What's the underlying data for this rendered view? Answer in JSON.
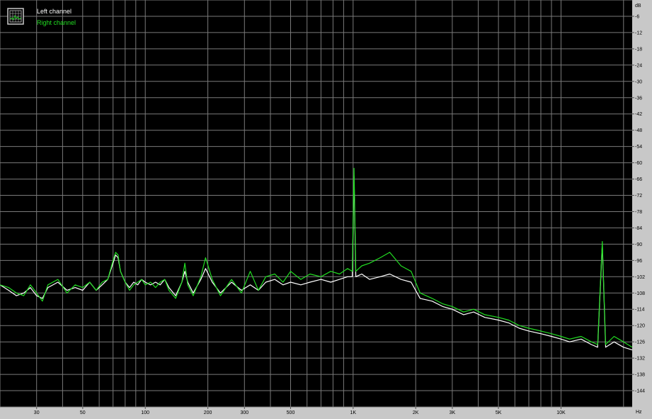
{
  "chart_data": {
    "type": "line",
    "title": "",
    "x_scale": "log",
    "xlim": [
      20,
      22000
    ],
    "ylim": [
      -150,
      0
    ],
    "x_unit": "Hz",
    "y_unit": "dB",
    "x_tick_labels": [
      {
        "f": 30,
        "label": "30"
      },
      {
        "f": 50,
        "label": "50"
      },
      {
        "f": 100,
        "label": "100"
      },
      {
        "f": 200,
        "label": "200"
      },
      {
        "f": 300,
        "label": "300"
      },
      {
        "f": 500,
        "label": "500"
      },
      {
        "f": 1000,
        "label": "1K"
      },
      {
        "f": 2000,
        "label": "2K"
      },
      {
        "f": 3000,
        "label": "3K"
      },
      {
        "f": 5000,
        "label": "5K"
      },
      {
        "f": 10000,
        "label": "10K"
      }
    ],
    "y_tick_labels": [
      "-6",
      "-12",
      "-18",
      "-24",
      "-30",
      "-36",
      "-42",
      "-48",
      "-54",
      "-60",
      "-66",
      "-72",
      "-78",
      "-84",
      "-90",
      "-96",
      "-102",
      "-108",
      "-114",
      "-120",
      "-126",
      "-132",
      "-138",
      "-144"
    ],
    "grid": true,
    "legend_position": "top-left",
    "colors": {
      "background": "#000000",
      "grid": "#7a7a7a",
      "frame": "#c8c8c8",
      "left": "#ffffff",
      "right": "#22dd22"
    },
    "legend": {
      "left_label": "Left channel",
      "right_label": "Right channel",
      "icon": "graph-icon"
    },
    "series": [
      {
        "name": "Left channel",
        "points": [
          [
            20,
            -105
          ],
          [
            22,
            -107
          ],
          [
            24,
            -109
          ],
          [
            26,
            -108
          ],
          [
            28,
            -106
          ],
          [
            30,
            -109
          ],
          [
            32,
            -110
          ],
          [
            34,
            -106
          ],
          [
            38,
            -104
          ],
          [
            42,
            -107
          ],
          [
            46,
            -106
          ],
          [
            50,
            -107
          ],
          [
            54,
            -104
          ],
          [
            58,
            -107
          ],
          [
            62,
            -105
          ],
          [
            66,
            -103
          ],
          [
            70,
            -97
          ],
          [
            72,
            -94
          ],
          [
            74,
            -95
          ],
          [
            76,
            -100
          ],
          [
            80,
            -104
          ],
          [
            84,
            -106
          ],
          [
            88,
            -104
          ],
          [
            92,
            -105
          ],
          [
            96,
            -103
          ],
          [
            100,
            -104
          ],
          [
            106,
            -105
          ],
          [
            112,
            -104
          ],
          [
            118,
            -105
          ],
          [
            124,
            -103
          ],
          [
            130,
            -106
          ],
          [
            140,
            -109
          ],
          [
            150,
            -104
          ],
          [
            155,
            -100
          ],
          [
            160,
            -104
          ],
          [
            170,
            -108
          ],
          [
            185,
            -103
          ],
          [
            195,
            -99
          ],
          [
            210,
            -104
          ],
          [
            230,
            -108
          ],
          [
            260,
            -104
          ],
          [
            290,
            -107
          ],
          [
            320,
            -105
          ],
          [
            350,
            -107
          ],
          [
            380,
            -104
          ],
          [
            420,
            -103
          ],
          [
            460,
            -105
          ],
          [
            500,
            -104
          ],
          [
            560,
            -105
          ],
          [
            620,
            -104
          ],
          [
            700,
            -103
          ],
          [
            780,
            -104
          ],
          [
            860,
            -103
          ],
          [
            940,
            -102
          ],
          [
            990,
            -102
          ],
          [
            1010,
            -65
          ],
          [
            1030,
            -102
          ],
          [
            1100,
            -101
          ],
          [
            1200,
            -103
          ],
          [
            1350,
            -102
          ],
          [
            1500,
            -101
          ],
          [
            1700,
            -103
          ],
          [
            1900,
            -104
          ],
          [
            2100,
            -110
          ],
          [
            2400,
            -111
          ],
          [
            2700,
            -113
          ],
          [
            3000,
            -114
          ],
          [
            3400,
            -116
          ],
          [
            3800,
            -115
          ],
          [
            4300,
            -117
          ],
          [
            5000,
            -118
          ],
          [
            5600,
            -119
          ],
          [
            6300,
            -121
          ],
          [
            7000,
            -122
          ],
          [
            8000,
            -123
          ],
          [
            9000,
            -124
          ],
          [
            10000,
            -125
          ],
          [
            11000,
            -126
          ],
          [
            12500,
            -125
          ],
          [
            14000,
            -127
          ],
          [
            15000,
            -128
          ],
          [
            15800,
            -90
          ],
          [
            16400,
            -128
          ],
          [
            18000,
            -126
          ],
          [
            20000,
            -128
          ],
          [
            22000,
            -129
          ]
        ]
      },
      {
        "name": "Right channel",
        "points": [
          [
            20,
            -105
          ],
          [
            22,
            -106
          ],
          [
            24,
            -108
          ],
          [
            26,
            -109
          ],
          [
            28,
            -105
          ],
          [
            30,
            -108
          ],
          [
            32,
            -111
          ],
          [
            34,
            -105
          ],
          [
            38,
            -103
          ],
          [
            42,
            -108
          ],
          [
            46,
            -105
          ],
          [
            50,
            -106
          ],
          [
            54,
            -104
          ],
          [
            58,
            -107
          ],
          [
            62,
            -104
          ],
          [
            66,
            -103
          ],
          [
            70,
            -96
          ],
          [
            72,
            -93
          ],
          [
            74,
            -94
          ],
          [
            76,
            -100
          ],
          [
            80,
            -104
          ],
          [
            84,
            -107
          ],
          [
            88,
            -105
          ],
          [
            92,
            -104
          ],
          [
            96,
            -103
          ],
          [
            100,
            -105
          ],
          [
            106,
            -104
          ],
          [
            112,
            -106
          ],
          [
            118,
            -104
          ],
          [
            124,
            -103
          ],
          [
            130,
            -107
          ],
          [
            140,
            -110
          ],
          [
            150,
            -104
          ],
          [
            155,
            -97
          ],
          [
            160,
            -105
          ],
          [
            170,
            -109
          ],
          [
            185,
            -102
          ],
          [
            195,
            -95
          ],
          [
            210,
            -103
          ],
          [
            230,
            -109
          ],
          [
            260,
            -103
          ],
          [
            290,
            -108
          ],
          [
            320,
            -100
          ],
          [
            350,
            -107
          ],
          [
            380,
            -102
          ],
          [
            420,
            -101
          ],
          [
            460,
            -104
          ],
          [
            500,
            -100
          ],
          [
            560,
            -103
          ],
          [
            620,
            -101
          ],
          [
            700,
            -102
          ],
          [
            780,
            -100
          ],
          [
            860,
            -101
          ],
          [
            940,
            -99
          ],
          [
            990,
            -100
          ],
          [
            1010,
            -62
          ],
          [
            1030,
            -100
          ],
          [
            1100,
            -98
          ],
          [
            1200,
            -97
          ],
          [
            1350,
            -95
          ],
          [
            1500,
            -93
          ],
          [
            1700,
            -98
          ],
          [
            1900,
            -100
          ],
          [
            2100,
            -108
          ],
          [
            2400,
            -110
          ],
          [
            2700,
            -112
          ],
          [
            3000,
            -113
          ],
          [
            3400,
            -115
          ],
          [
            3800,
            -114
          ],
          [
            4300,
            -116
          ],
          [
            5000,
            -117
          ],
          [
            5600,
            -118
          ],
          [
            6300,
            -120
          ],
          [
            7000,
            -121
          ],
          [
            8000,
            -122
          ],
          [
            9000,
            -123
          ],
          [
            10000,
            -124
          ],
          [
            11000,
            -125
          ],
          [
            12500,
            -124
          ],
          [
            14000,
            -126
          ],
          [
            15000,
            -127
          ],
          [
            15800,
            -89
          ],
          [
            16400,
            -127
          ],
          [
            18000,
            -124
          ],
          [
            20000,
            -126
          ],
          [
            22000,
            -128
          ]
        ]
      }
    ]
  }
}
